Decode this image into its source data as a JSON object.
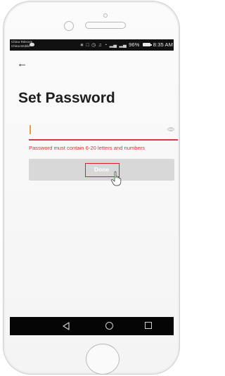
{
  "status_bar": {
    "carrier_line1": "China Telecom",
    "carrier_line2": "China Mobile",
    "status_text": "®ᴴᴸl ᴴᴸl 96%",
    "time": "8:35 AM"
  },
  "page": {
    "title": "Set Password",
    "password_value": "",
    "error_message": "Password must contain 6-20 letters and numbers",
    "done_label": "Done"
  },
  "icons": {
    "back": "back-arrow-icon",
    "visibility": "eye-icon",
    "cursor": "hand-pointer-icon"
  },
  "colors": {
    "error": "#d43a35",
    "caret": "#e4a03a",
    "button_disabled": "#d8d8d8",
    "highlight_box": "#e02020"
  }
}
